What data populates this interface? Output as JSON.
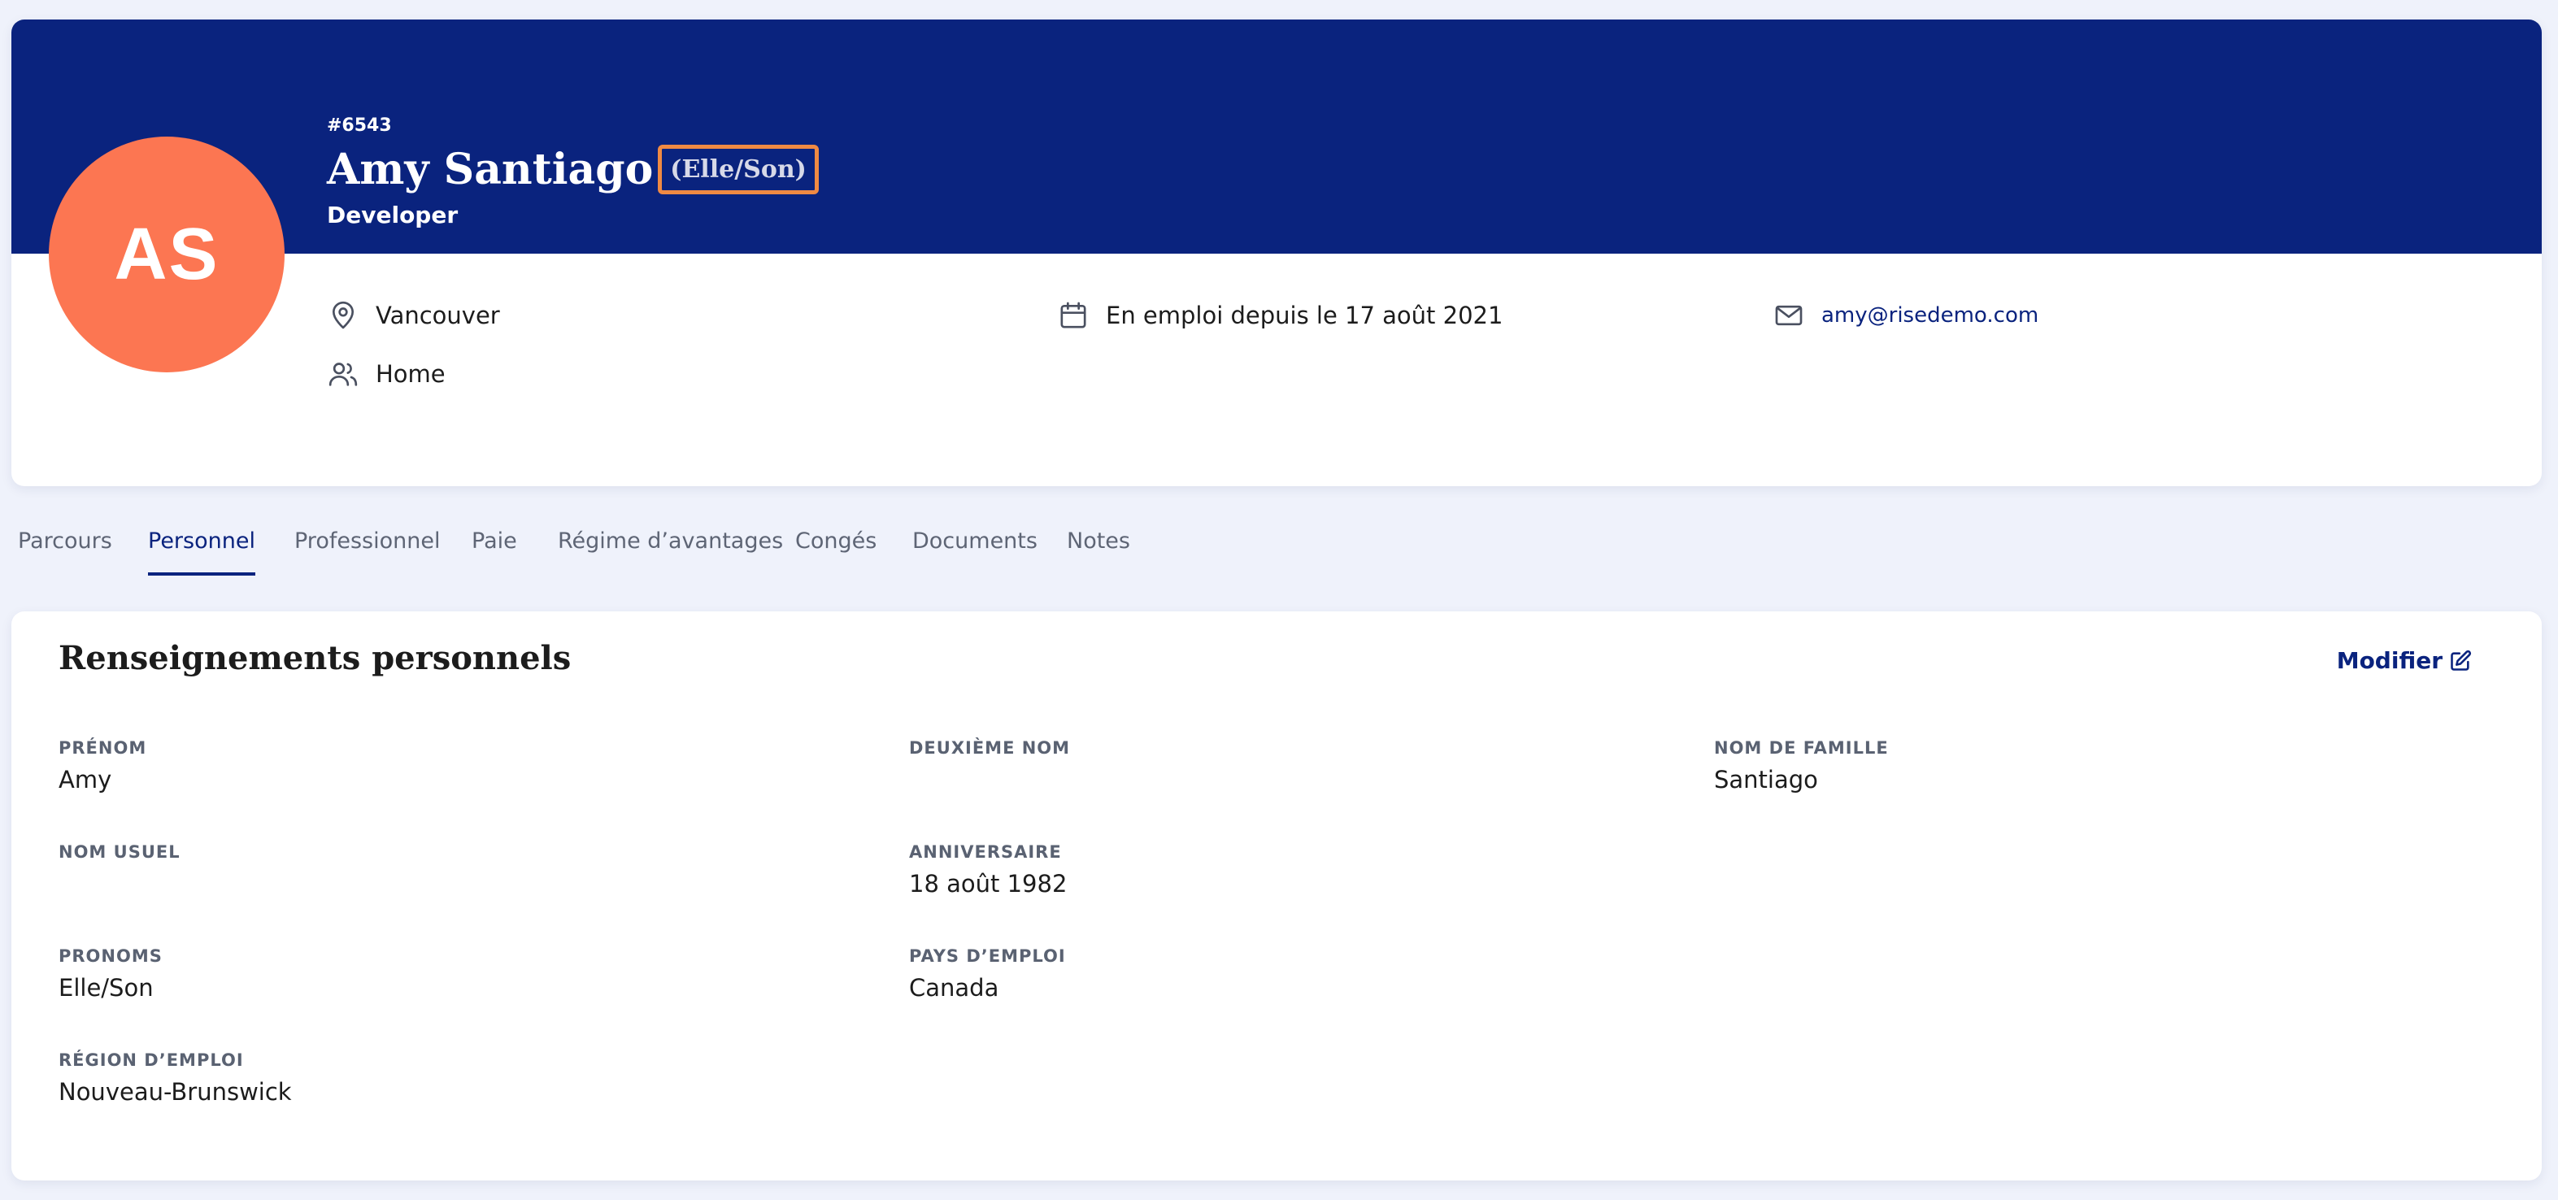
{
  "colors": {
    "banner": "#0a237e",
    "avatar": "#fc7652",
    "highlight_border": "#f08a43",
    "accent": "#0a237e",
    "background": "#eff2fb"
  },
  "profile": {
    "employee_id": "#6543",
    "name": "Amy Santiago",
    "pronouns": "(Elle/Son)",
    "job_title": "Developer",
    "initials": "AS",
    "location": "Vancouver",
    "location_icon": "map-pin-icon",
    "employment_since": "En emploi depuis le 17 août 2021",
    "calendar_icon": "calendar-icon",
    "email": "amy@risedemo.com",
    "email_icon": "mail-icon",
    "department": "Home",
    "department_icon": "users-icon"
  },
  "tabs": [
    {
      "label": "Parcours",
      "active": false
    },
    {
      "label": "Personnel",
      "active": true
    },
    {
      "label": "Professionnel",
      "active": false
    },
    {
      "label": "Paie",
      "active": false
    },
    {
      "label": "Régime d’avantages",
      "active": false
    },
    {
      "label": "Congés",
      "active": false
    },
    {
      "label": "Documents",
      "active": false
    },
    {
      "label": "Notes",
      "active": false
    }
  ],
  "personal_section": {
    "title": "Renseignements personnels",
    "edit_label": "Modifier",
    "edit_icon": "edit-icon",
    "fields": {
      "first_name": {
        "label": "PRÉNOM",
        "value": "Amy"
      },
      "middle_name": {
        "label": "DEUXIÈME NOM",
        "value": ""
      },
      "last_name": {
        "label": "NOM DE FAMILLE",
        "value": "Santiago"
      },
      "preferred_name": {
        "label": "NOM USUEL",
        "value": ""
      },
      "birthday": {
        "label": "ANNIVERSAIRE",
        "value": "18 août 1982"
      },
      "pronouns": {
        "label": "PRONOMS",
        "value": "Elle/Son"
      },
      "country": {
        "label": "PAYS D’EMPLOI",
        "value": "Canada"
      },
      "region": {
        "label": "RÉGION D’EMPLOI",
        "value": "Nouveau-Brunswick"
      }
    }
  }
}
